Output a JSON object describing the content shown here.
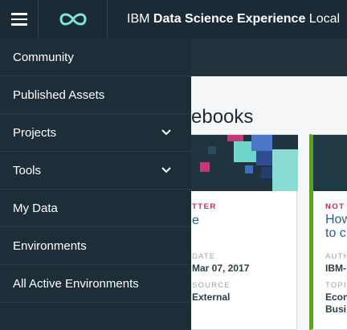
{
  "header": {
    "brand_prefix": "IBM",
    "brand_bold": "Data Science Experience",
    "brand_suffix": "Local",
    "menu_icon": "hamburger-icon",
    "logo_icon": "infinity-logo-icon",
    "colors": {
      "bar": "#1b2a34",
      "logo": "#7fe6d6"
    }
  },
  "drawer": {
    "items": [
      {
        "label": "Community",
        "has_chevron": false
      },
      {
        "label": "Published Assets",
        "has_chevron": false
      },
      {
        "label": "Projects",
        "has_chevron": true
      },
      {
        "label": "Tools",
        "has_chevron": true
      },
      {
        "label": "My Data",
        "has_chevron": false
      },
      {
        "label": "Environments",
        "has_chevron": false
      },
      {
        "label": "All Active Environments",
        "has_chevron": false
      }
    ]
  },
  "background_page": {
    "section_title": "ebooks",
    "card1": {
      "type_label": "TTER",
      "title_fragment": "e",
      "meta1_label": "DATE",
      "meta1_value": "Mar 07, 2017",
      "meta2_label": "SOURCE",
      "meta2_value": "External"
    },
    "card2": {
      "type_label": "NOT",
      "title_line1": "How",
      "title_line2": "to c",
      "meta1_label": "AUTH",
      "meta1_value": "IBM-",
      "meta2_label": "TOPI",
      "meta2_value_line1": "Econ",
      "meta2_value_line2": "Busi",
      "accent": "#5aa700"
    }
  }
}
